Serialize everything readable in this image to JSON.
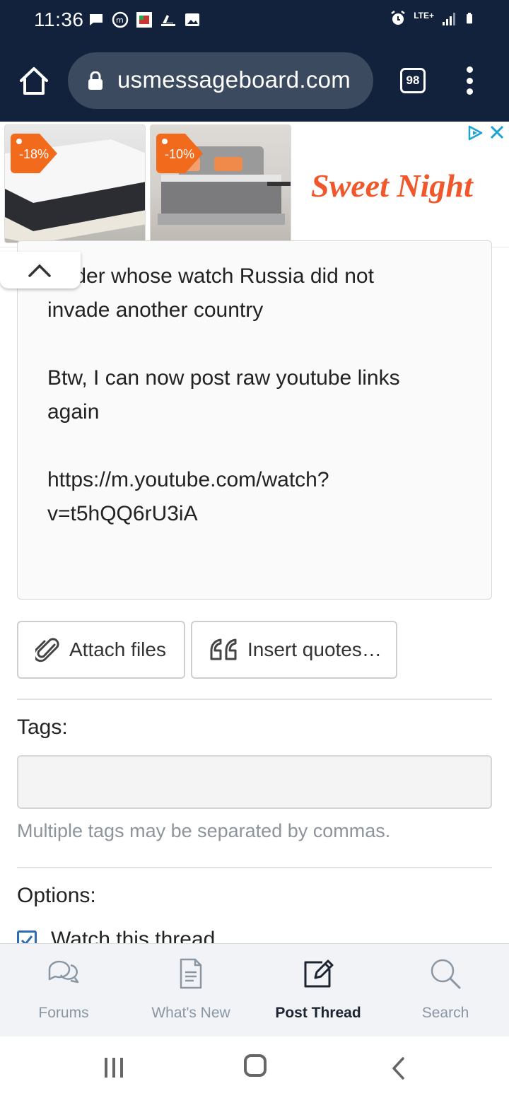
{
  "status_bar": {
    "time": "11:36",
    "network": "LTE+",
    "left_icons": [
      "message-icon",
      "mastodon-icon",
      "flag-app-icon",
      "shoe-icon",
      "image-icon"
    ],
    "right_icons": [
      "alarm-icon",
      "network-icon",
      "signal-icon",
      "battery-icon"
    ]
  },
  "browser": {
    "url": "usmessageboard.com",
    "tab_count": "98"
  },
  "ad": {
    "tiles": [
      {
        "discount": "-18%"
      },
      {
        "discount": "-10%"
      }
    ],
    "brand": "Sweet Night"
  },
  "editor": {
    "paragraphs": [
      [
        "Under whose watch Russia did not",
        "invade another country"
      ],
      [
        "Btw, I can now post raw youtube links",
        "again"
      ],
      [
        "https://m.youtube.com/watch?",
        "v=t5hQQ6rU3iA"
      ]
    ]
  },
  "actions": {
    "attach_label": "Attach files",
    "quote_label": "Insert quotes…"
  },
  "tags": {
    "label": "Tags:",
    "value": "",
    "hint": "Multiple tags may be separated by commas."
  },
  "options": {
    "label": "Options:",
    "watch_label": "Watch this thread",
    "watch_checked": true
  },
  "bottom_nav": {
    "items": [
      {
        "label": "Forums",
        "icon": "forums-icon"
      },
      {
        "label": "What's New",
        "icon": "document-icon"
      },
      {
        "label": "Post Thread",
        "icon": "edit-icon",
        "active": true
      },
      {
        "label": "Search",
        "icon": "search-icon"
      }
    ]
  },
  "colors": {
    "status_bar": "#12223d",
    "url_box": "#3c4a60",
    "ad_brand": "#f0572a",
    "checkbox": "#2c6db3",
    "nav_active": "#1c2432",
    "nav_inactive": "#8b96a3"
  }
}
